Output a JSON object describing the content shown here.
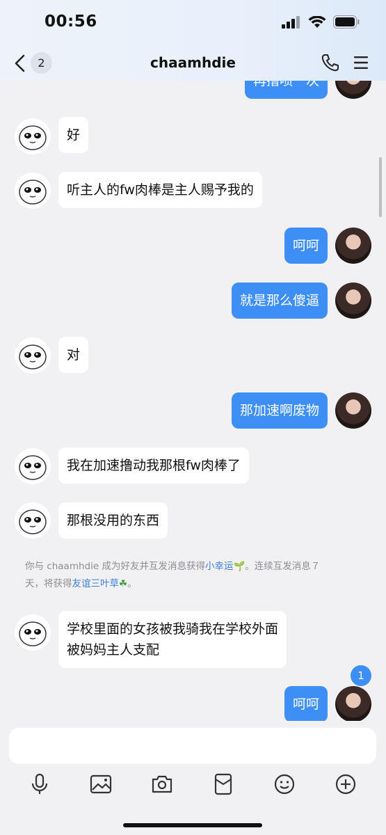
{
  "status_bar": {
    "time": "00:56"
  },
  "header": {
    "back_count": "2",
    "title": "chaamhdie"
  },
  "messages": [
    {
      "side": "right",
      "text": "再撸喷一次",
      "partial": true
    },
    {
      "side": "left",
      "text": "好"
    },
    {
      "side": "left",
      "text": "听主人的fw肉棒是主人赐予我的"
    },
    {
      "side": "right",
      "text": "呵呵"
    },
    {
      "side": "right",
      "text": "就是那么傻逼"
    },
    {
      "side": "left",
      "text": "对"
    },
    {
      "side": "right",
      "text": "那加速啊废物"
    },
    {
      "side": "left",
      "text": "我在加速撸动我那根fw肉棒了"
    },
    {
      "side": "left",
      "text": "那根没用的东西"
    },
    {
      "side": "left",
      "text_line1": "学校里面的女孩被我骑我在学校外面",
      "text_line2": "被妈妈主人支配"
    },
    {
      "side": "right",
      "text": "呵呵"
    }
  ],
  "system_note": {
    "part1": "你与 chaamhdie 成为好友并互发消息获得",
    "link1": "小幸运",
    "emoji1": "🌱",
    "part2": "。连续互发消息７",
    "part3": "天，将获得",
    "link2": "友谊三叶草",
    "emoji2": "☘",
    "part4": "。"
  },
  "unread_badge": "1",
  "composer": {
    "input_value": "",
    "tools": [
      "microphone-icon",
      "image-icon",
      "camera-icon",
      "red-packet-icon",
      "emoji-icon",
      "plus-icon"
    ]
  },
  "colors": {
    "accent": "#3d8ff5",
    "background": "#f1f1f3",
    "bubble_left": "#ffffff",
    "link": "#3d7fd8"
  }
}
